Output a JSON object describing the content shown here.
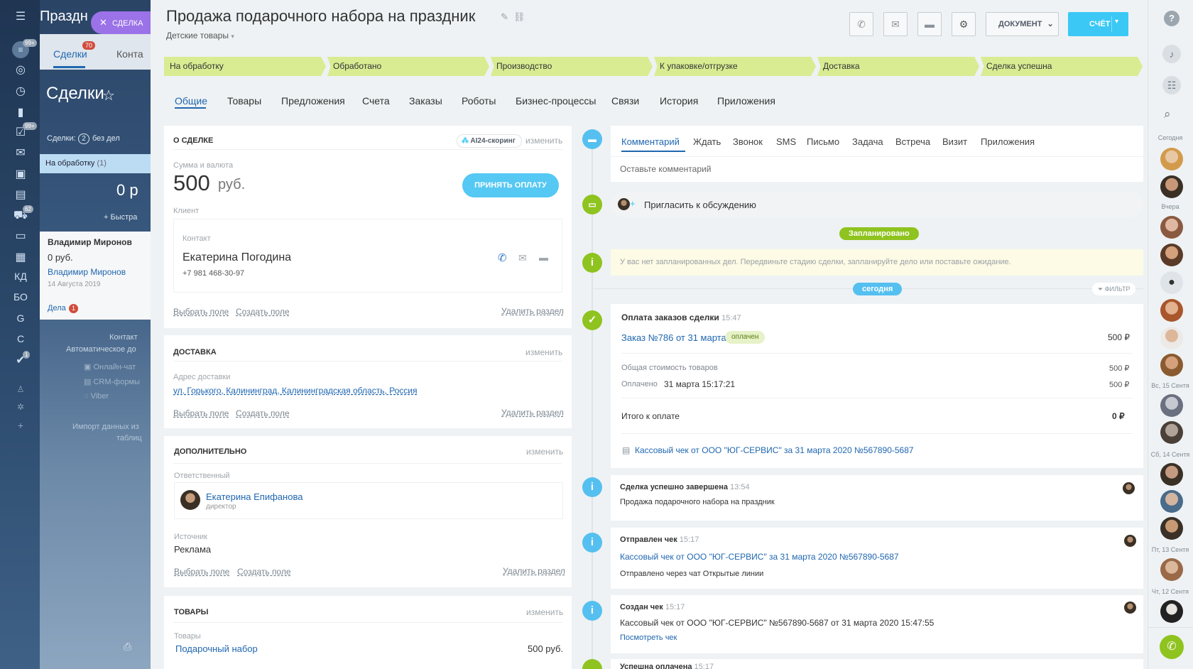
{
  "leftnav": {
    "badge_top": "99+",
    "badge_tasks": "99+",
    "badge_shop": "62",
    "badge_one": "1",
    "text_items": [
      "КД",
      "БО",
      "G",
      "C"
    ]
  },
  "bg": {
    "title_partial": "Праздн",
    "tab_deals": "Сделки",
    "tab_deals_badge": "70",
    "tab_contacts": "Конта",
    "page_title": "Сделки",
    "deals_label": "Сделки:",
    "deals_count": "2",
    "no_deals": "без дел",
    "stage_name": "На обработку",
    "stage_count": "(1)",
    "amount": "0 р",
    "quick_add": "+ Быстра",
    "deal_name": "Владимир Миронов",
    "deal_sum": "0 руб.",
    "deal_contact": "Владимир Миронов",
    "deal_date": "14 Августа 2019",
    "deal_tasks": "Дела",
    "deal_tasks_badge": "1",
    "bottom_1": "Контакт",
    "bottom_2": "Автоматическое до",
    "bottom_3": "Онлайн-чат",
    "bottom_4": "CRM-формы",
    "bottom_5": "Viber",
    "bottom_6": "Импорт данных из",
    "bottom_7": "таблиц"
  },
  "close_tab": {
    "label": "СДЕЛКА"
  },
  "header": {
    "title": "Продажа подарочного набора на праздник",
    "category": "Детские товары",
    "document_btn": "ДОКУМЕНТ",
    "invoice_btn": "СЧЁТ"
  },
  "stages": [
    "На обработку",
    "Обработано",
    "Производство",
    "К упаковке/отгрузке",
    "Доставка",
    "Сделка успешна"
  ],
  "tabs": [
    "Общие",
    "Товары",
    "Предложения",
    "Счета",
    "Заказы",
    "Роботы",
    "Бизнес-процессы",
    "Связи",
    "История",
    "Приложения"
  ],
  "about": {
    "header": "О СДЕЛКЕ",
    "ai_scoring": "AI24-скоринг",
    "change": "изменить",
    "sum_label": "Сумма и валюта",
    "sum": "500",
    "currency": "руб.",
    "pay_btn": "ПРИНЯТЬ ОПЛАТУ",
    "client_label": "Клиент",
    "contact_label": "Контакт",
    "contact_name": "Екатерина Погодина",
    "contact_phone": "+7 981 468-30-97",
    "select_field": "Выбрать поле",
    "create_field": "Создать поле",
    "delete_section": "Удалить раздел"
  },
  "delivery": {
    "header": "ДОСТАВКА",
    "change": "изменить",
    "address_label": "Адрес доставки",
    "address": "ул. Горького, Калининград, Калининградская область, Россия",
    "select_field": "Выбрать поле",
    "create_field": "Создать поле",
    "delete_section": "Удалить раздел"
  },
  "additional": {
    "header": "ДОПОЛНИТЕЛЬНО",
    "change": "изменить",
    "responsible_label": "Ответственный",
    "responsible_name": "Екатерина Епифанова",
    "responsible_role": "директор",
    "source_label": "Источник",
    "source": "Реклама",
    "select_field": "Выбрать поле",
    "create_field": "Создать поле",
    "delete_section": "Удалить раздел"
  },
  "goods": {
    "header": "ТОВАРЫ",
    "change": "изменить",
    "goods_label": "Товары",
    "item": "Подарочный набор",
    "price": "500 руб."
  },
  "timeline": {
    "tabs": [
      "Комментарий",
      "Ждать",
      "Звонок",
      "SMS",
      "Письмо",
      "Задача",
      "Встреча",
      "Визит",
      "Приложения"
    ],
    "comment_placeholder": "Оставьте комментарий",
    "invite": "Пригласить к обсуждению",
    "planned": "Запланировано",
    "no_planned": "У вас нет запланированных дел. Передвиньте стадию сделки, запланируйте дело или поставьте ожидание.",
    "today": "сегодня",
    "filter": "ФИЛЬТР",
    "payment": {
      "title": "Оплата заказов сделки",
      "time": "15:47",
      "order": "Заказ №786 от 31 марта",
      "paid_badge": "оплачен",
      "order_sum": "500 ₽",
      "total_label": "Общая стоимость товаров",
      "total_value": "500 ₽",
      "paid_label": "Оплачено",
      "paid_date": "31 марта 15:17:21",
      "paid_value": "500 ₽",
      "to_pay_label": "Итого к оплате",
      "to_pay_value": "0 ₽",
      "receipt": "Кассовый чек от ООО \"ЮГ-СЕРВИС\" за 31 марта 2020 №567890-5687"
    },
    "completed": {
      "title": "Сделка успешно завершена",
      "time": "13:54",
      "text": "Продажа подарочного набора на праздник"
    },
    "sent": {
      "title": "Отправлен чек",
      "time": "15:17",
      "link": "Кассовый чек от ООО \"ЮГ-СЕРВИС\" за 31 марта 2020 №567890-5687",
      "text": "Отправлено через чат Открытые линии"
    },
    "created": {
      "title": "Создан чек",
      "time": "15:17",
      "text": "Кассовый чек от ООО \"ЮГ-СЕРВИС\" №567890-5687 от 31 марта 2020 15:47:55",
      "link": "Посмотреть чек"
    },
    "partial": {
      "title": "Успешна оплачена",
      "time": "15:17"
    }
  },
  "rightrail": {
    "dates": [
      "Сегодня",
      "Вчера",
      "Вс, 15 Сентя",
      "Сб, 14 Сентя",
      "Пт, 13 Сентя",
      "Чт, 12 Сентя"
    ]
  },
  "colors": {
    "stage": "#d9ec92",
    "accent": "#2067b0",
    "primary_btn": "#3bc8f5",
    "success": "#8fc31f",
    "info": "#55c0f0"
  }
}
